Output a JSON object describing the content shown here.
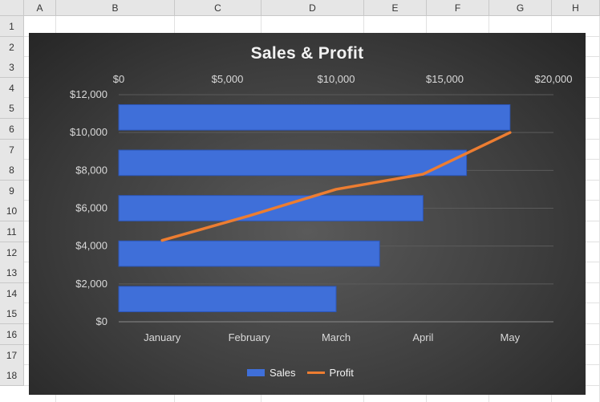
{
  "spreadsheet": {
    "columns": [
      "A",
      "B",
      "C",
      "D",
      "E",
      "F",
      "G",
      "H"
    ],
    "rows": [
      "1",
      "2",
      "3",
      "4",
      "5",
      "6",
      "7",
      "8",
      "9",
      "10",
      "11",
      "12",
      "13",
      "14",
      "15",
      "16",
      "17",
      "18"
    ]
  },
  "legend": {
    "sales": "Sales",
    "profit": "Profit"
  },
  "chart_data": {
    "type": "bar",
    "title": "Sales & Profit",
    "categories": [
      "January",
      "February",
      "March",
      "April",
      "May"
    ],
    "primary_axis_labels": [
      "$0",
      "$2,000",
      "$4,000",
      "$6,000",
      "$8,000",
      "$10,000",
      "$12,000"
    ],
    "secondary_axis_labels": [
      "$0",
      "$5,000",
      "$10,000",
      "$15,000",
      "$20,000"
    ],
    "xlim": [
      0,
      20000
    ],
    "ylim": [
      0,
      12000
    ],
    "series": [
      {
        "name": "Sales",
        "type": "bar",
        "axis": "secondary",
        "orientation": "horizontal",
        "values": [
          10000,
          12000,
          14000,
          16000,
          18000
        ],
        "color": "#3f6fd9"
      },
      {
        "name": "Profit",
        "type": "line",
        "axis": "primary",
        "values": [
          4300,
          5600,
          7000,
          7800,
          10000
        ],
        "color": "#ed7d31"
      }
    ],
    "legend_position": "bottom",
    "grid": true
  },
  "colors": {
    "chart_bg": "#3f3f3f",
    "bar": "#3f6fd9",
    "line": "#ed7d31",
    "text": "#d9d9d9"
  }
}
